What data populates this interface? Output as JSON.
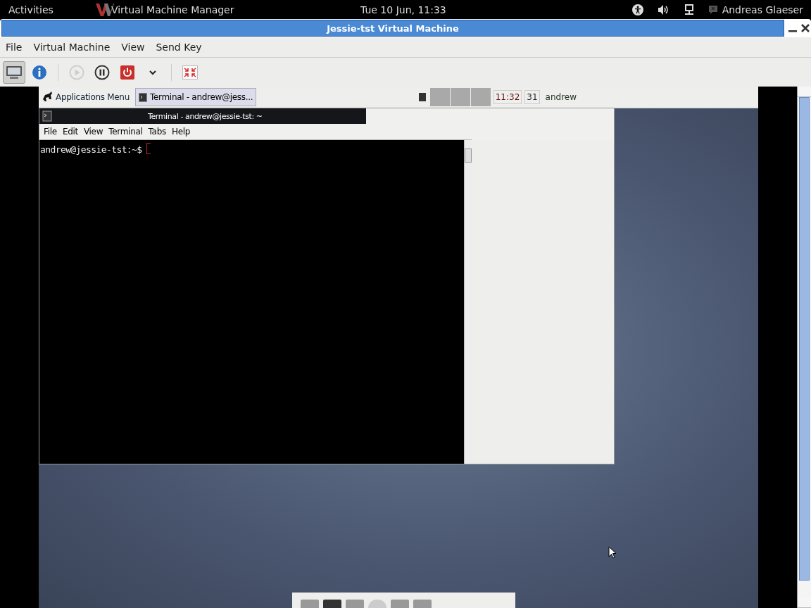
{
  "top_bar": {
    "activities": "Activities",
    "app_name": "Virtual Machine Manager",
    "clock": "Tue 10 Jun, 11:33",
    "user": "Andreas Glaeser"
  },
  "window": {
    "title": "Jessie-tst Virtual Machine"
  },
  "menu": [
    "File",
    "Virtual Machine",
    "View",
    "Send Key"
  ],
  "toolbar": [
    {
      "kind": "console",
      "selected": true,
      "disabled": false
    },
    {
      "kind": "details",
      "selected": false,
      "disabled": false
    },
    {
      "kind": "run",
      "selected": false,
      "disabled": true
    },
    {
      "kind": "pause",
      "selected": false,
      "disabled": false
    },
    {
      "kind": "power",
      "selected": false,
      "disabled": false
    },
    {
      "kind": "dropdown",
      "selected": false,
      "disabled": false
    },
    {
      "kind": "fullscreen",
      "selected": false,
      "disabled": false
    }
  ],
  "guest": {
    "panel": {
      "apps_menu": "Applications Menu",
      "tasks": [
        {
          "label": "Terminal - andrew@jess...",
          "selected": true
        }
      ],
      "clock": "11:32",
      "date": "31",
      "user": "andrew"
    },
    "terminal": {
      "title": "Terminal - andrew@jessie-tst: ~",
      "menu": [
        "File",
        "Edit",
        "View",
        "Terminal",
        "Tabs",
        "Help"
      ],
      "prompt": "andrew@jessie-tst:~$"
    }
  }
}
